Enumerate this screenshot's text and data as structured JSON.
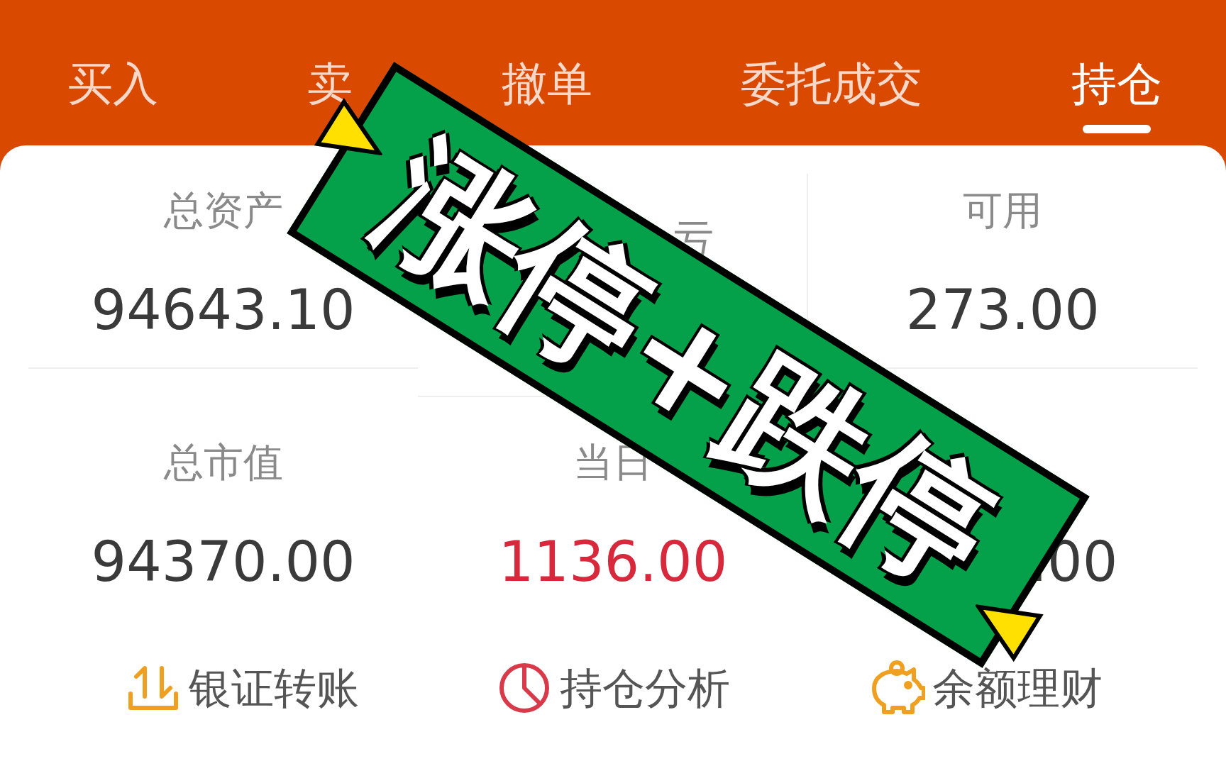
{
  "tabs": [
    {
      "label": "买入",
      "selected": false
    },
    {
      "label": "卖",
      "selected": false
    },
    {
      "label": "撤单",
      "selected": false
    },
    {
      "label": "委托成交",
      "selected": false
    },
    {
      "label": "持仓",
      "selected": true
    }
  ],
  "stats": [
    {
      "label": "总资产",
      "value": "94643.10",
      "kind": "plain"
    },
    {
      "label": "亏",
      "kind": "cut"
    },
    {
      "label": "可用",
      "value": "273.00",
      "kind": "plain"
    },
    {
      "label": "总市值",
      "value": "94370.00",
      "kind": "plain"
    },
    {
      "label": "当日",
      "value": "1136.00",
      "kind": "up"
    },
    {
      "value": ".00",
      "kind": "cut"
    }
  ],
  "links": [
    {
      "label": "银证转账"
    },
    {
      "label": "持仓分析"
    },
    {
      "label": "余额理财"
    }
  ],
  "sticker": {
    "text": "涨停+跌停"
  }
}
